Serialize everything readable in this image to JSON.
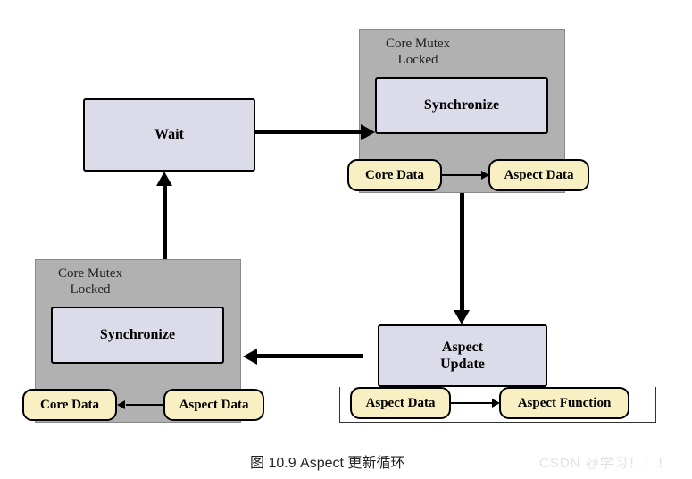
{
  "nodes": {
    "wait": "Wait",
    "top_mutex": {
      "title": "Core Mutex\nLocked",
      "sync": "Synchronize",
      "core": "Core Data",
      "aspect": "Aspect Data"
    },
    "aspect_update": {
      "title": "Aspect\nUpdate",
      "data": "Aspect Data",
      "func": "Aspect Function"
    },
    "bottom_mutex": {
      "title": "Core Mutex\nLocked",
      "sync": "Synchronize",
      "core": "Core Data",
      "aspect": "Aspect Data"
    }
  },
  "caption": "图 10.9 Aspect 更新循环",
  "watermark": "CSDN @学习！！！"
}
